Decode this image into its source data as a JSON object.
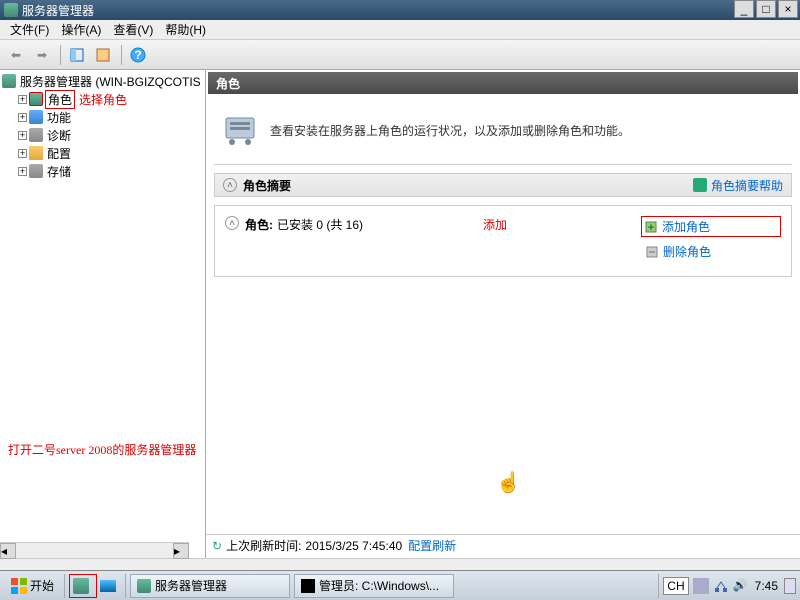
{
  "window": {
    "title": "服务器管理器",
    "min": "_",
    "max": "□",
    "close": "×"
  },
  "menu": {
    "file": "文件(F)",
    "action": "操作(A)",
    "view": "查看(V)",
    "help": "帮助(H)"
  },
  "tree": {
    "root": "服务器管理器 (WIN-BGIZQCOTIS",
    "roles": "角色",
    "features": "功能",
    "diagnostics": "诊断",
    "config": "配置",
    "storage": "存储"
  },
  "annotations": {
    "select_role": "选择角色",
    "add": "添加",
    "open_server": "打开二号server 2008的服务器管理器"
  },
  "right": {
    "header": "角色",
    "description": "查看安装在服务器上角色的运行状况，以及添加或删除角色和功能。",
    "summary_title": "角色摘要",
    "summary_help": "角色摘要帮助",
    "roles_label": "角色:",
    "roles_status": "已安装 0 (共 16)",
    "add_role": "添加角色",
    "remove_role": "删除角色"
  },
  "refresh": {
    "label": "上次刷新时间:",
    "timestamp": "2015/3/25 7:45:40",
    "link": "配置刷新"
  },
  "taskbar": {
    "start": "开始",
    "task1": "服务器管理器",
    "task2": "管理员: C:\\Windows\\...",
    "lang": "CH",
    "clock": "7:45"
  }
}
